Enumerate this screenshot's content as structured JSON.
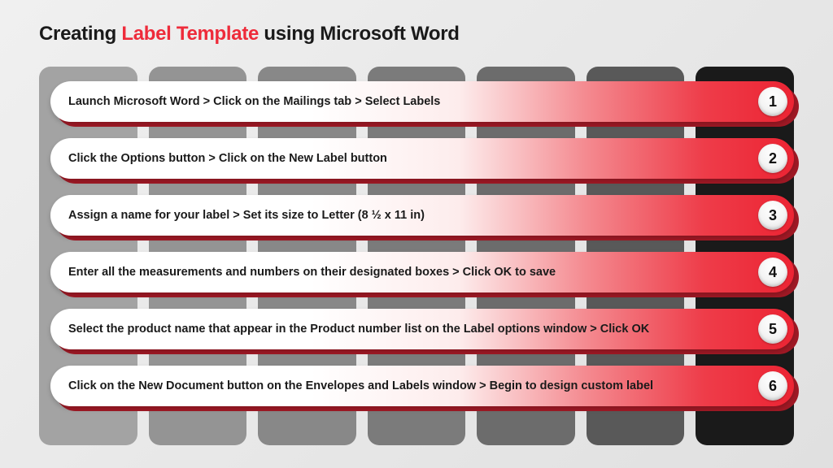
{
  "title": {
    "pre": "Creating ",
    "accent": "Label Template",
    "post": " using Microsoft Word"
  },
  "columns": [
    "#a3a3a3",
    "#949494",
    "#888888",
    "#7b7b7b",
    "#6c6c6c",
    "#595959",
    "#1a1a1a"
  ],
  "steps": [
    {
      "n": "1",
      "text": "Launch Microsoft Word > Click on the Mailings tab > Select Labels"
    },
    {
      "n": "2",
      "text": "Click the Options button > Click on the New Label button"
    },
    {
      "n": "3",
      "text": "Assign a name for your label > Set its size to Letter (8 ½ x 11 in)"
    },
    {
      "n": "4",
      "text": "Enter all the measurements and numbers on their designated boxes > Click OK to save"
    },
    {
      "n": "5",
      "text": "Select the product name that appear in the Product number list on the Label options window > Click OK"
    },
    {
      "n": "6",
      "text": "Click on the New Document button on the Envelopes and Labels window > Begin to design custom label"
    }
  ]
}
